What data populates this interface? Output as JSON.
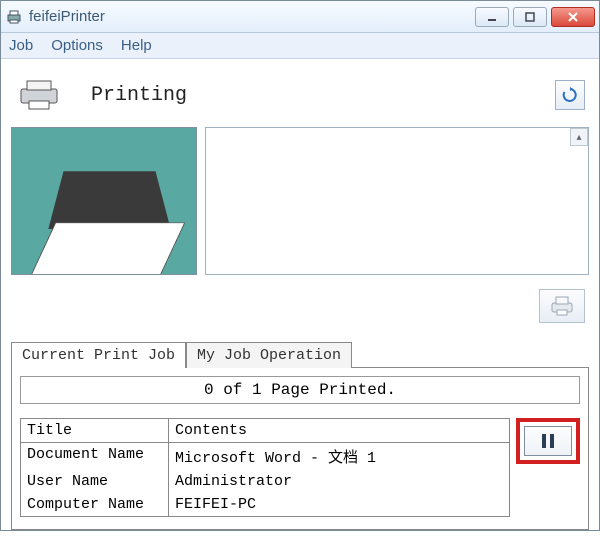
{
  "window": {
    "title": "feifeiPrinter"
  },
  "menu": {
    "job": "Job",
    "options": "Options",
    "help": "Help"
  },
  "status": {
    "text": "Printing"
  },
  "tabs": {
    "current": "Current Print Job",
    "myop": "My Job Operation"
  },
  "page_status": "0 of 1 Page Printed.",
  "detail": {
    "header_title": "Title",
    "header_contents": "Contents",
    "rows": [
      {
        "title": "Document Name",
        "contents": "Microsoft Word - 文档 1"
      },
      {
        "title": "User Name",
        "contents": "Administrator"
      },
      {
        "title": "Computer Name",
        "contents": "FEIFEI-PC"
      }
    ]
  }
}
